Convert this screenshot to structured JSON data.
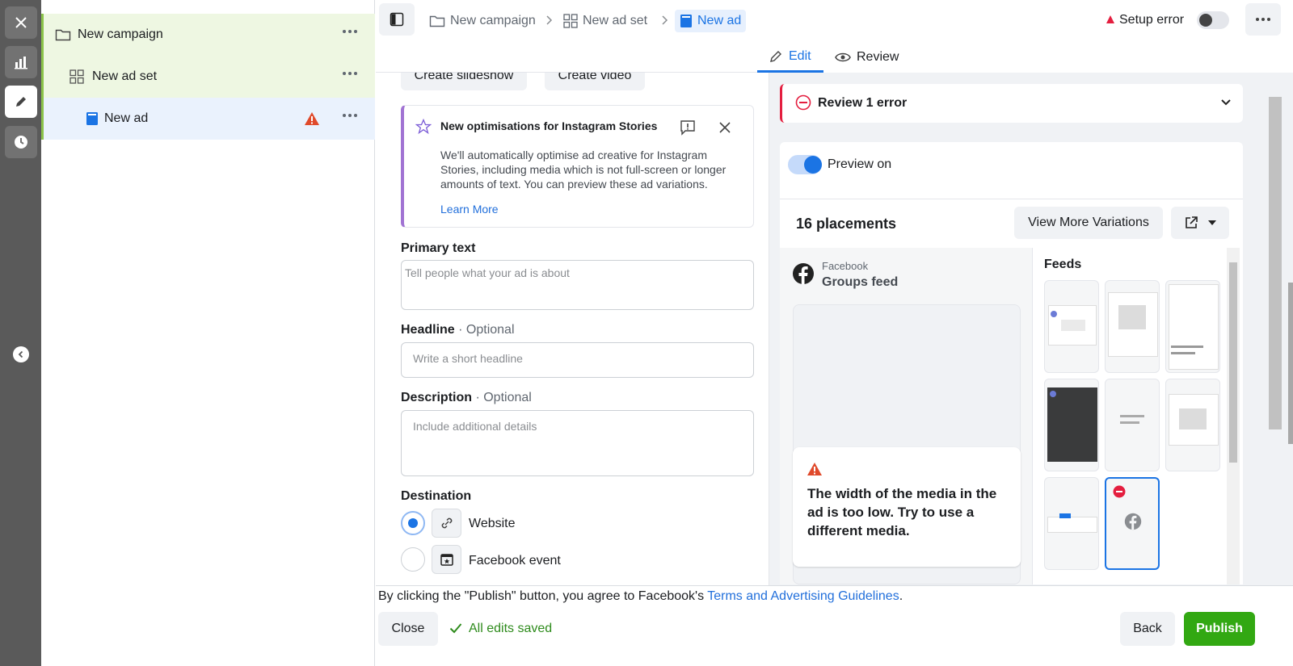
{
  "colors": {
    "accent": "#1b74e4",
    "publish": "#32a812",
    "error": "#e41e3f",
    "warning": "#d93025",
    "rail": "#5a5a5a",
    "green_highlight": "#f0f8e8",
    "blue_highlight": "#eaf2fd"
  },
  "rail": {
    "icons": [
      "close-icon",
      "chart-icon",
      "pencil-icon",
      "clock-icon",
      "chevron-left-icon"
    ]
  },
  "tree": {
    "items": [
      {
        "label": "New campaign",
        "icon": "folder-icon"
      },
      {
        "label": "New ad set",
        "icon": "grid-icon"
      },
      {
        "label": "New ad",
        "icon": "ad-icon"
      }
    ]
  },
  "breadcrumb": {
    "items": [
      "New campaign",
      "New ad set",
      "New ad"
    ]
  },
  "header": {
    "setup_error": "Setup error"
  },
  "tabs": [
    {
      "label": "Edit"
    },
    {
      "label": "Review"
    }
  ],
  "form": {
    "buttons": [
      "Create slideshow",
      "Create video"
    ],
    "notice": {
      "title": "New optimisations for Instagram Stories",
      "body": "We'll automatically optimise ad creative for Instagram Stories, including media which is not full-screen or longer amounts of text. You can preview these ad variations.",
      "link": "Learn More"
    },
    "primary_text": {
      "label": "Primary text",
      "placeholder": "Tell people what your ad is about"
    },
    "headline": {
      "label": "Headline",
      "optional": " · Optional",
      "placeholder": "Write a short headline"
    },
    "description": {
      "label": "Description",
      "optional": " · Optional",
      "placeholder": "Include additional details"
    },
    "destination": {
      "label": "Destination",
      "options": [
        {
          "label": "Website",
          "selected": true
        },
        {
          "label": "Facebook event",
          "selected": false
        }
      ]
    }
  },
  "preview": {
    "review_error": "Review 1 error",
    "preview_toggle": "Preview on",
    "placements": "16 placements",
    "view_more": "View More Variations",
    "platform": "Facebook",
    "placement_name": "Groups feed",
    "error_message": "The width of the media in the ad is too low. Try to use a different media.",
    "feeds_title": "Feeds"
  },
  "footer": {
    "agreement_prefix": "By clicking the \"Publish\" button, you agree to Facebook's ",
    "agreement_link": "Terms and Advertising Guidelines",
    "agreement_suffix": ".",
    "close": "Close",
    "saved": "All edits saved",
    "back": "Back",
    "publish": "Publish"
  }
}
